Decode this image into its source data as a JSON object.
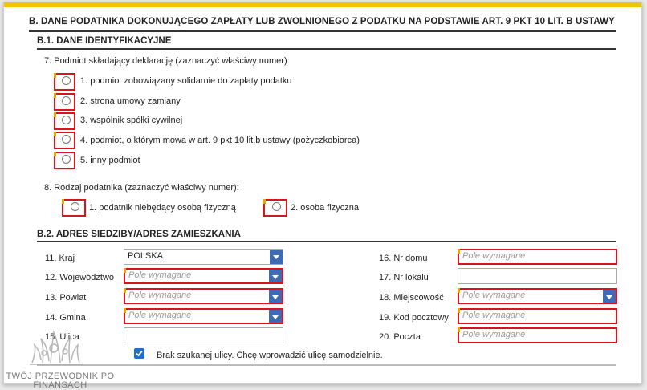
{
  "section_b": {
    "title": "B. DANE PODATNIKA DOKONUJĄCEGO ZAPŁATY LUB ZWOLNIONEGO Z PODATKU NA PODSTAWIE ART. 9 PKT 10 LIT. B USTAWY"
  },
  "b1": {
    "title": "B.1. DANE IDENTYFIKACYJNE",
    "q7": "7. Podmiot składający deklarację (zaznaczyć właściwy numer):",
    "q7_options": [
      "1. podmiot zobowiązany solidarnie do zapłaty podatku",
      "2. strona umowy zamiany",
      "3. wspólnik spółki cywilnej",
      "4. podmiot, o którym mowa w art. 9 pkt 10 lit.b ustawy (pożyczkobiorca)",
      "5. inny podmiot"
    ],
    "q8": "8. Rodzaj podatnika (zaznaczyć właściwy numer):",
    "q8_options": [
      "1. podatnik niebędący osobą fizyczną",
      "2. osoba fizyczna"
    ]
  },
  "b2": {
    "title": "B.2. ADRES SIEDZIBY/ADRES ZAMIESZKANIA",
    "placeholder": "Pole wymagane",
    "kraj": {
      "label": "11. Kraj",
      "value": "POLSKA"
    },
    "wojewodztwo": {
      "label": "12. Województwo"
    },
    "powiat": {
      "label": "13. Powiat"
    },
    "gmina": {
      "label": "14. Gmina"
    },
    "ulica": {
      "label": "15. Ulica"
    },
    "nr_domu": {
      "label": "16. Nr domu"
    },
    "nr_lokalu": {
      "label": "17. Nr lokalu"
    },
    "miejscowosc": {
      "label": "18. Miejscowość"
    },
    "kod_pocztowy": {
      "label": "19. Kod pocztowy"
    },
    "poczta": {
      "label": "20. Poczta"
    },
    "checkbox_label": "Brak szukanej ulicy. Chcę wprowadzić ulicę samodzielnie.",
    "checkbox_checked": true
  },
  "watermark": {
    "line1": "TWÓJ PRZEWODNIK PO",
    "line2": "FINANSACH"
  },
  "colors": {
    "accent": "#f2c500",
    "required_border": "#d9141c",
    "dropdown": "#3d6cb5",
    "checkbox": "#1f6fd0"
  }
}
